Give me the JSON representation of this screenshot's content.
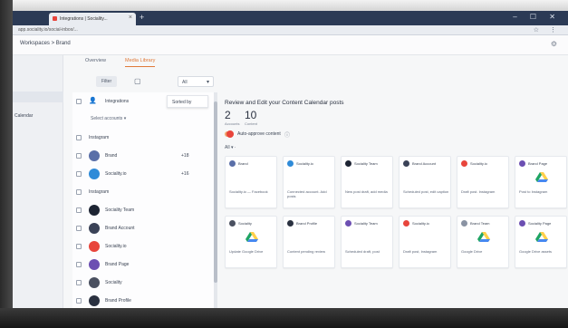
{
  "browser": {
    "tab_title": "Integrations | Sociality...",
    "url": "app.sociality.io/social-inbox/..."
  },
  "header": {
    "breadcrumb": "Workspaces  >  Brand"
  },
  "library": {
    "tabs": [
      {
        "label": "Overview"
      },
      {
        "label": "Media Library"
      }
    ]
  },
  "toolbar": {
    "pill": "Filter",
    "dropdown_value": "All"
  },
  "list": {
    "rows": [
      {
        "text": "Integrations",
        "num": "",
        "avatar": "",
        "kind": "header"
      },
      {
        "text": "Select accounts",
        "num": "",
        "avatar": "",
        "kind": "filter"
      },
      {
        "text": "Instagram",
        "num": "",
        "avatar": "",
        "kind": "plain"
      },
      {
        "text": "Brand",
        "num": "+18",
        "avatar": "#5a6fa8",
        "kind": "avatar"
      },
      {
        "text": "Sociality.io",
        "num": "+16",
        "avatar": "#2f8bd8",
        "kind": "avatar"
      },
      {
        "text": "Instagram",
        "num": "",
        "avatar": "",
        "kind": "plain"
      },
      {
        "text": "Sociality Team",
        "num": "",
        "avatar": "#1d2433",
        "kind": "avatar"
      },
      {
        "text": "Brand Account",
        "num": "",
        "avatar": "#3a4257",
        "kind": "avatar"
      },
      {
        "text": "Sociality.io",
        "num": "",
        "avatar": "#e8453c",
        "kind": "avatar"
      },
      {
        "text": "Brand Page",
        "num": "",
        "avatar": "#6c4fb2",
        "kind": "avatar"
      },
      {
        "text": "Sociality",
        "num": "",
        "avatar": "#4a5060",
        "kind": "avatar"
      },
      {
        "text": "Brand Profile",
        "num": "",
        "avatar": "#2a3140",
        "kind": "avatar"
      }
    ],
    "sort_menu": "Sorted by"
  },
  "right": {
    "title": "Review and Edit your Content Calendar posts",
    "stats": [
      {
        "num": "2",
        "cap": "Accounts"
      },
      {
        "num": "10",
        "cap": "Content"
      }
    ],
    "toggle_label": "Auto-approve content",
    "control": "All    ▾  ·",
    "cards": [
      {
        "head": "Brand",
        "body": "Sociality.io — Facebook",
        "avatar": "#5a6fa8",
        "drive": false
      },
      {
        "head": "Sociality.io",
        "body": "Connected account. Add posts",
        "avatar": "#2f8bd8",
        "drive": false
      },
      {
        "head": "Sociality Team",
        "body": "New post draft, add media",
        "avatar": "#1d2433",
        "drive": false
      },
      {
        "head": "Brand Account",
        "body": "Scheduled post, edit caption",
        "avatar": "#3a4257",
        "drive": false
      },
      {
        "head": "Sociality.io",
        "body": "Draft post. Instagram",
        "avatar": "#e8453c",
        "drive": false
      },
      {
        "head": "Brand Page",
        "body": "Post to Instagram",
        "avatar": "#6c4fb2",
        "drive": true
      },
      {
        "head": "Sociality",
        "body": "Update Google Drive",
        "avatar": "#4a5060",
        "drive": true
      },
      {
        "head": "Brand Profile",
        "body": "Content pending review",
        "avatar": "#2a3140",
        "drive": false
      },
      {
        "head": "Sociality Team",
        "body": "Scheduled draft, post",
        "avatar": "#6c4fb2",
        "drive": false
      },
      {
        "head": "Sociality.io",
        "body": "Draft post, Instagram",
        "avatar": "#e8453c",
        "drive": false
      },
      {
        "head": "Brand Team",
        "body": "Google Drive",
        "avatar": "#8a93a3",
        "drive": true
      },
      {
        "head": "Sociality Page",
        "body": "Google Drive assets",
        "avatar": "#6c4fb2",
        "drive": true
      }
    ]
  },
  "leftnav": {
    "label": "Calendar"
  },
  "colors": {
    "accent": "#e07a3a",
    "drive_green": "#1fa463",
    "drive_yellow": "#ffd04b",
    "drive_blue": "#4688f1"
  }
}
